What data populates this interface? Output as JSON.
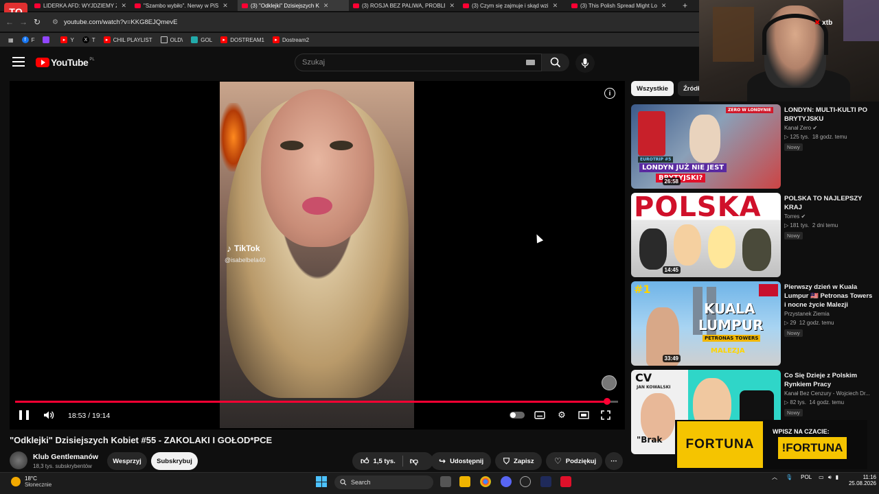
{
  "browser": {
    "tabs": [
      {
        "label": "LIDERKA AFD: WYJDZIEMY ZE S",
        "active": false
      },
      {
        "label": "\"Szambo wybiło\". Nerwy w PiS",
        "active": false
      },
      {
        "label": "(3) \"Odklejki\" Dzisiejszych K",
        "active": true
      },
      {
        "label": "(3) ROSJA BEZ PALIWA, PROBLE",
        "active": false
      },
      {
        "label": "(3) Czym się zajmuje i skąd wzi",
        "active": false
      },
      {
        "label": "(3) This Polish Spread Might Lo",
        "active": false
      }
    ],
    "new_tab_label": "+",
    "url": "youtube.com/watch?v=KKG8EJQmevE",
    "bookmarks": [
      {
        "label": "F",
        "color": "#1877f2"
      },
      {
        "label": "",
        "color": "#9146ff"
      },
      {
        "label": "Y",
        "color": "#ff0000"
      },
      {
        "label": "T",
        "color": "#000000"
      },
      {
        "label": "CHIL PLAYLIST",
        "color": "#ff0000"
      },
      {
        "label": "OLD\\",
        "color": "#777777"
      },
      {
        "label": "GOL",
        "color": "#2aa"
      },
      {
        "label": "DOSTREAM1",
        "color": "#ff0000"
      },
      {
        "label": "Dostream2",
        "color": "#ff0000"
      }
    ]
  },
  "youtube": {
    "logo_text": "YouTube",
    "logo_country": "PL",
    "search_placeholder": "Szukaj"
  },
  "player": {
    "tiktok_label": "TikTok",
    "tiktok_user": "@isabelbela40",
    "current_time": "18:53",
    "duration": "19:14",
    "time_display": "18:53 / 19:14",
    "progress_fraction": 0.982
  },
  "video": {
    "title": "\"Odklejki\" Dzisiejszych Kobiet #55 - ZAKOLAKI I GOŁOD*PCE",
    "channel_name": "Klub Gentlemanów",
    "channel_subs": "18,3 tys. subskrybentów",
    "support_label": "Wesprzyj",
    "subscribe_label": "Subskrybuj",
    "likes": "1,5 tys.",
    "share_label": "Udostępnij",
    "save_label": "Zapisz",
    "thanks_label": "Podziękuj"
  },
  "sidebar": {
    "chips": [
      "Wszystkie",
      "Źródło"
    ],
    "recommendations": [
      {
        "title": "LONDYN: MULTI-KULTI PO BRYTYJSKU",
        "channel": "Kanał Zero",
        "views": "125 tys.",
        "age": "18 godz. temu",
        "badge": "Nowy",
        "duration": "26:58",
        "thumb_lines": [
          "EUROTRIP #5",
          "LONDYN JUŻ NIE JEST",
          "BRYTYJSKI?"
        ],
        "thumb_tag": "ZERO W LONDYNIE"
      },
      {
        "title": "POLSKA TO NAJLEPSZY KRAJ",
        "channel": "Torres",
        "views": "181 tys.",
        "age": "2 dni temu",
        "badge": "Nowy",
        "duration": "14:45",
        "thumb_lines": [
          "POLSKA"
        ]
      },
      {
        "title": "Pierwszy dzień w Kuala Lumpur 🇲🇾 Petronas Towers i nocne życie Malezji",
        "channel": "Przystanek Ziemia",
        "views": "29",
        "age": "12 godz. temu",
        "badge": "Nowy",
        "duration": "33:49",
        "thumb_lines": [
          "#1",
          "KUALA",
          "LUMPUR",
          "PETRONAS TOWERS",
          "MALEZJA"
        ]
      },
      {
        "title": "Co Się Dzieje z Polskim Rynkiem Pracy",
        "channel": "Kanał Bez Cenzury - Wojciech Dr...",
        "views": "82 tys.",
        "age": "14 godz. temu",
        "badge": "Nowy",
        "thumb_lines": [
          "CV",
          "JAN KOWALSKI",
          "\"Brak"
        ]
      }
    ]
  },
  "overlay": {
    "xtb_label": "xtb",
    "ad_brand": "FORTUNA",
    "ad_cta": "WPISZ NA CZACIE:",
    "ad_code": "!FORTUNA"
  },
  "taskbar": {
    "temperature": "18°C",
    "weather": "Słonecznie",
    "search_label": "Search",
    "language": "POL",
    "time": "11:16",
    "date": "25.08.2026"
  }
}
